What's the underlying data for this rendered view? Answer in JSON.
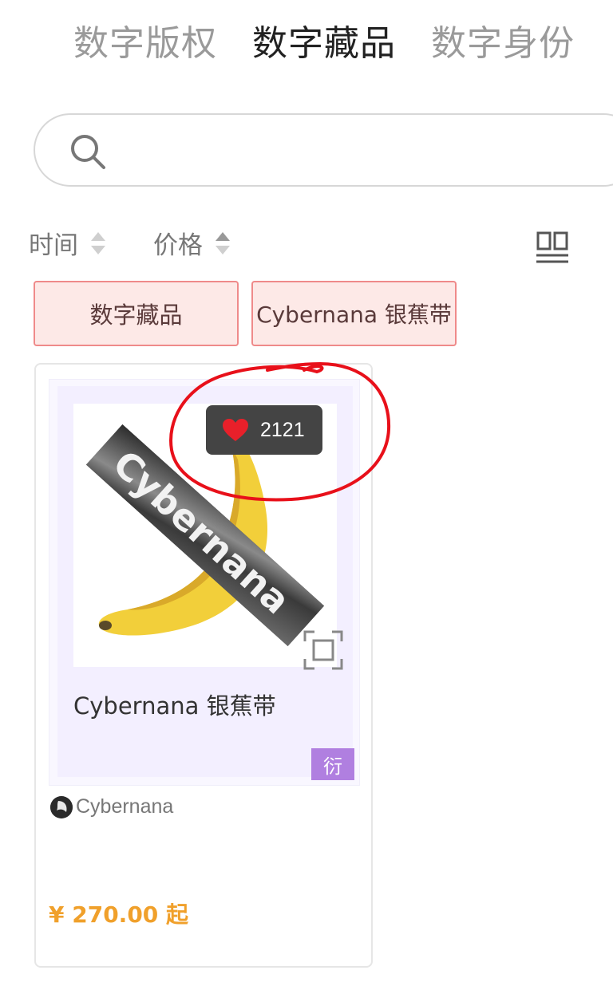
{
  "tabs": [
    {
      "label": "数字版权",
      "active": false
    },
    {
      "label": "数字藏品",
      "active": true
    },
    {
      "label": "数字身份",
      "active": false
    }
  ],
  "search": {
    "placeholder": "",
    "value": "",
    "icon": "search-icon"
  },
  "sort": {
    "time_label": "时间",
    "price_label": "价格",
    "layout_icon": "grid-toggle-icon"
  },
  "chips": [
    "数字藏品",
    "Cybernana 银蕉带"
  ],
  "colors": {
    "chip_border": "#ef8a8a",
    "chip_bg": "#fde9e7",
    "price": "#f0a02b",
    "badge": "#b07fe0",
    "likes_bg": "#444444",
    "heart": "#e8202a",
    "annotation": "#e8101a"
  },
  "product": {
    "likes": "2121",
    "title": "Cybernana 银蕉带",
    "badge": "衍",
    "creator": "Cybernana",
    "price": "¥ 270.00 起"
  }
}
